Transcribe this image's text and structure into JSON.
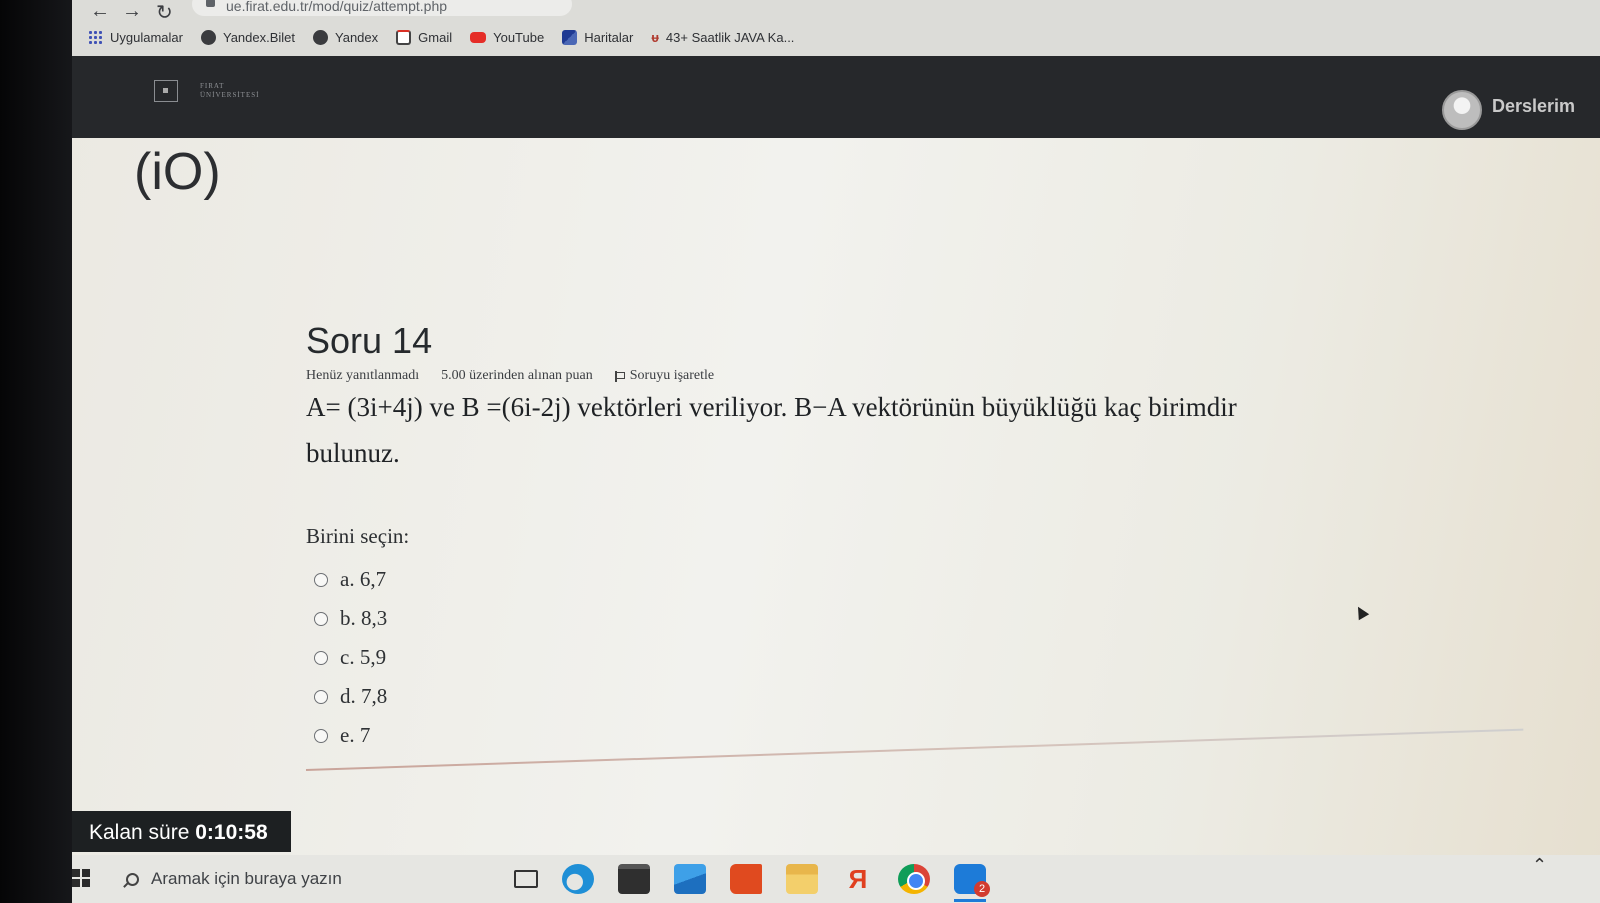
{
  "browser": {
    "url": "ue.firat.edu.tr/mod/quiz/attempt.php",
    "bookmarks": [
      {
        "label": "Uygulamalar",
        "icon": "apps-grid-icon"
      },
      {
        "label": "Yandex.Bilet",
        "icon": "yandex-icon"
      },
      {
        "label": "Yandex",
        "icon": "yandex-icon"
      },
      {
        "label": "Gmail",
        "icon": "gmail-icon"
      },
      {
        "label": "YouTube",
        "icon": "youtube-icon"
      },
      {
        "label": "Haritalar",
        "icon": "maps-icon"
      },
      {
        "label": "43+ Saatlik JAVA Ka...",
        "icon": "udemy-icon"
      }
    ]
  },
  "header": {
    "logo_line1": "FIRAT",
    "logo_line2": "ÜNİVERSİTESİ",
    "nav_link": "Derslerim"
  },
  "page": {
    "mark": "(iO)"
  },
  "question": {
    "title": "Soru 14",
    "status": "Henüz yanıtlanmadı",
    "points": "5.00 üzerinden alınan puan",
    "flag_label": "Soruyu işaretle",
    "text_line1": "A= (3i+4j) ve B =(6i-2j) vektörleri veriliyor. B−A vektörünün büyüklüğü kaç birimdir",
    "text_line2": "bulunuz.",
    "choose_label": "Birini seçin:",
    "options": [
      {
        "label": "a. 6,7"
      },
      {
        "label": "b. 8,3"
      },
      {
        "label": "c. 5,9"
      },
      {
        "label": "d. 7,8"
      },
      {
        "label": "e. 7"
      }
    ]
  },
  "timer": {
    "label": "Kalan süre",
    "value": "0:10:58"
  },
  "taskbar": {
    "search_placeholder": "Aramak için buraya yazın",
    "yandex_glyph": "Я",
    "skype_badge": "2"
  }
}
